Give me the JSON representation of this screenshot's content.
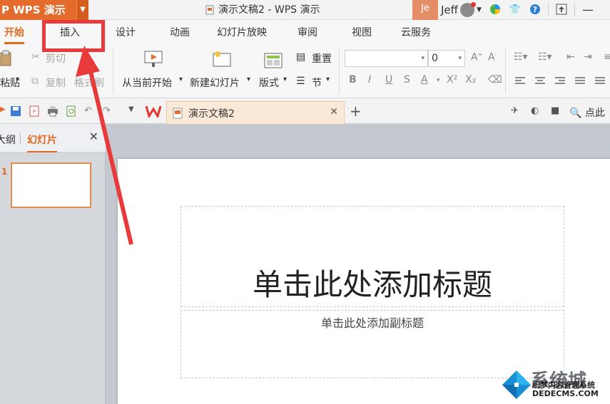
{
  "titlebar": {
    "app_name": "P WPS 演示",
    "doc_title": "演示文稿2 - WPS 演示",
    "avatar_text": "Je",
    "user_name": "Jeff"
  },
  "menu": {
    "tabs": [
      "开始",
      "插入",
      "设计",
      "动画",
      "幻灯片放映",
      "审阅",
      "视图",
      "云服务"
    ],
    "active": "开始"
  },
  "ribbon": {
    "cut": "剪切",
    "paste": "粘贴",
    "copy": "复制",
    "format_painter": "格式刷",
    "from_current": "从当前开始",
    "new_slide": "新建幻灯片",
    "layout": "版式",
    "reset": "重置",
    "section": "节",
    "font_size": "0",
    "bold": "B",
    "italic": "I",
    "underline": "U",
    "strike": "S",
    "font_color": "A",
    "superscript": "X²",
    "subscript": "X₂"
  },
  "quickbar": {
    "doc_tab": "演示文稿2",
    "search": "点此"
  },
  "panel": {
    "outline_tab": "大纲",
    "slides_tab": "幻灯片",
    "slide_number": "1"
  },
  "slide": {
    "title_placeholder": "单击此处添加标题",
    "subtitle_placeholder": "单击此处添加副标题"
  },
  "watermark": {
    "brand": "系统城",
    "line1": "织梦内容管理系统",
    "line2": "DEDECMS.COM"
  },
  "colors": {
    "accent": "#e06a20",
    "app_orange": "#e46b2b",
    "highlight_red": "#e83a3a"
  }
}
